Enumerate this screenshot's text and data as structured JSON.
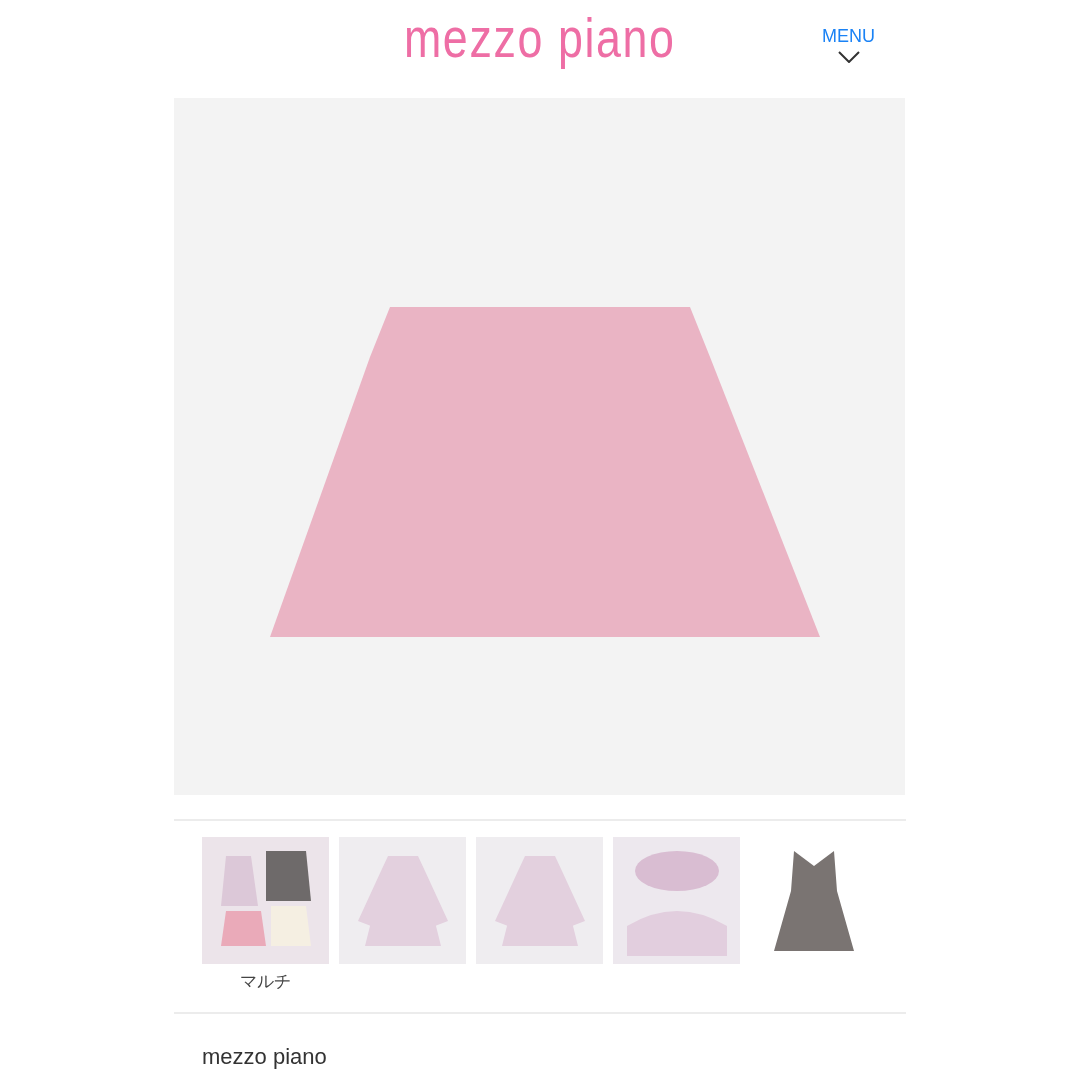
{
  "header": {
    "logo": "mezzo piano",
    "menu_label": "MENU"
  },
  "thumbnail_caption": "マルチ",
  "brand": "mezzo piano"
}
